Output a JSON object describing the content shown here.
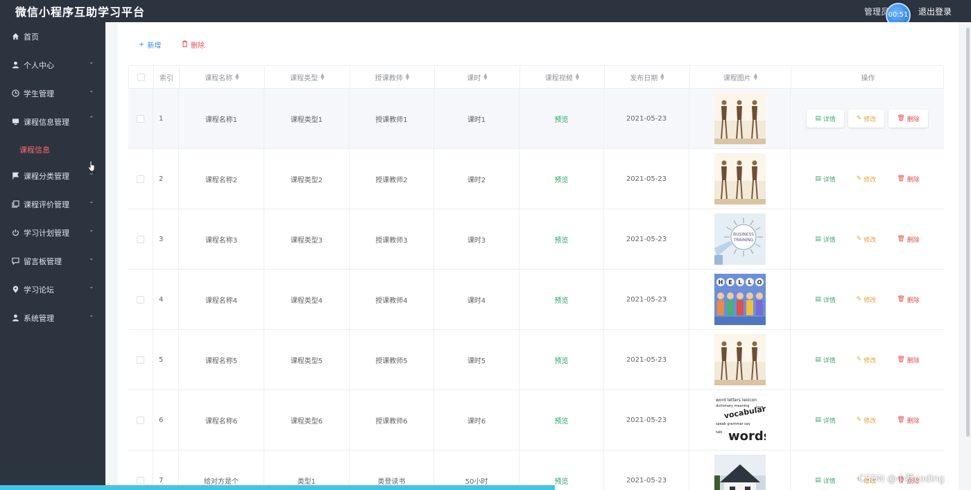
{
  "app": {
    "title": "微信小程序互助学习平台",
    "admin_label": "管理员",
    "timer": "00:51",
    "logout": "退出登录"
  },
  "sidebar": {
    "items": [
      {
        "label": "首页",
        "icon": "home-icon",
        "arrow": ""
      },
      {
        "label": "个人中心",
        "icon": "user-icon",
        "arrow": "⌄"
      },
      {
        "label": "学生管理",
        "icon": "clock-icon",
        "arrow": "⌄"
      },
      {
        "label": "课程信息管理",
        "icon": "monitor-icon",
        "arrow": "⌃"
      },
      {
        "label": "课程分类管理",
        "icon": "flag-icon",
        "arrow": "⌄"
      },
      {
        "label": "课程评价管理",
        "icon": "copy-icon",
        "arrow": "⌄"
      },
      {
        "label": "学习计划管理",
        "icon": "power-icon",
        "arrow": "⌄"
      },
      {
        "label": "留言板管理",
        "icon": "message-icon",
        "arrow": "⌄"
      },
      {
        "label": "学习论坛",
        "icon": "location-icon",
        "arrow": "⌄"
      },
      {
        "label": "系统管理",
        "icon": "user-icon",
        "arrow": "⌄"
      }
    ],
    "submenu": {
      "label": "课程信息"
    }
  },
  "toolbar": {
    "add_label": "新增",
    "delete_label": "删除"
  },
  "table": {
    "headers": [
      "索引",
      "课程名称",
      "课程类型",
      "授课教师",
      "课时",
      "课程视频",
      "发布日期",
      "课程图片",
      "操作"
    ],
    "rows": [
      {
        "index": "1",
        "name": "课程名称1",
        "type": "课程类型1",
        "teacher": "授课教师1",
        "hours": "课时1",
        "video": "预览",
        "date": "2021-05-23",
        "image": "dancers"
      },
      {
        "index": "2",
        "name": "课程名称2",
        "type": "课程类型2",
        "teacher": "授课教师2",
        "hours": "课时2",
        "video": "预览",
        "date": "2021-05-23",
        "image": "dancers"
      },
      {
        "index": "3",
        "name": "课程名称3",
        "type": "课程类型3",
        "teacher": "授课教师3",
        "hours": "课时3",
        "video": "预览",
        "date": "2021-05-23",
        "image": "business"
      },
      {
        "index": "4",
        "name": "课程名称4",
        "type": "课程类型4",
        "teacher": "授课教师4",
        "hours": "课时4",
        "video": "预览",
        "date": "2021-05-23",
        "image": "hello"
      },
      {
        "index": "5",
        "name": "课程名称5",
        "type": "课程类型5",
        "teacher": "授课教师5",
        "hours": "课时5",
        "video": "预览",
        "date": "2021-05-23",
        "image": "dancers"
      },
      {
        "index": "6",
        "name": "课程名称6",
        "type": "课程类型6",
        "teacher": "授课教师6",
        "hours": "课时6",
        "video": "预览",
        "date": "2021-05-23",
        "image": "words"
      },
      {
        "index": "7",
        "name": "给对方是个",
        "type": "类型1",
        "teacher": "类登读书",
        "hours": "50小时",
        "video": "预览",
        "date": "2021-05-23",
        "image": "house"
      }
    ],
    "actions": {
      "detail": "详情",
      "edit": "修改",
      "delete": "删除"
    }
  },
  "watermark": "CSDN @小蔡coding",
  "colors": {
    "sidebar_bg": "#2c3440",
    "active_submenu": "#ff6b6b",
    "primary": "#3a8ee6",
    "danger": "#e0504c",
    "success": "#3fae6e",
    "warning": "#e6a23c"
  }
}
